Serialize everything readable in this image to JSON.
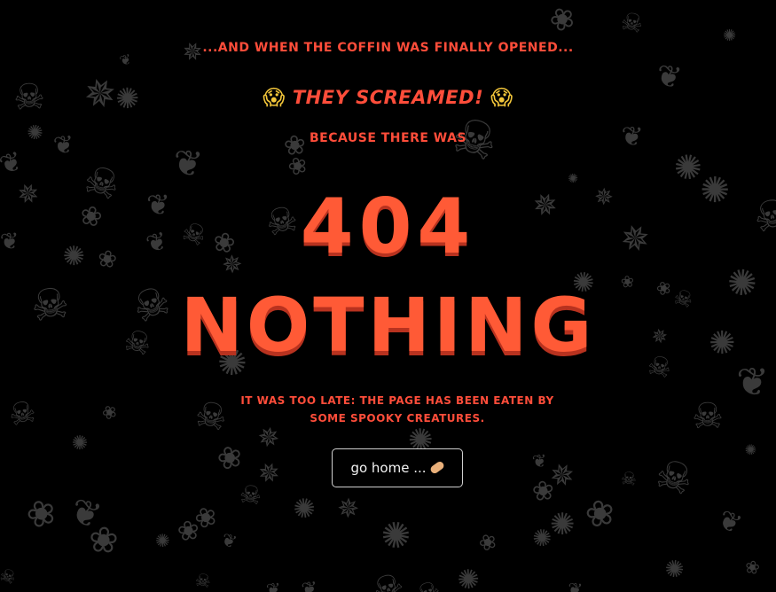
{
  "heading": {
    "line1": "...and when the coffin was finally opened...",
    "line2_text": "they screamed!",
    "line2_emoji_left": "😱",
    "line2_emoji_right": "😱",
    "line3": "because there was",
    "code": "404",
    "word": "NOTHING"
  },
  "message": "It was too late: the page has been eaten by some spooky creatures.",
  "home_button": {
    "label": "go home ...",
    "icon": "bandage-icon"
  },
  "background": {
    "icons": [
      "skull-icon",
      "ghost-icon",
      "bat-icon",
      "spider-icon",
      "spiderweb-icon"
    ]
  },
  "colors": {
    "background": "#000000",
    "accent": "#ff5a36",
    "creature": "#3a3a3a"
  }
}
